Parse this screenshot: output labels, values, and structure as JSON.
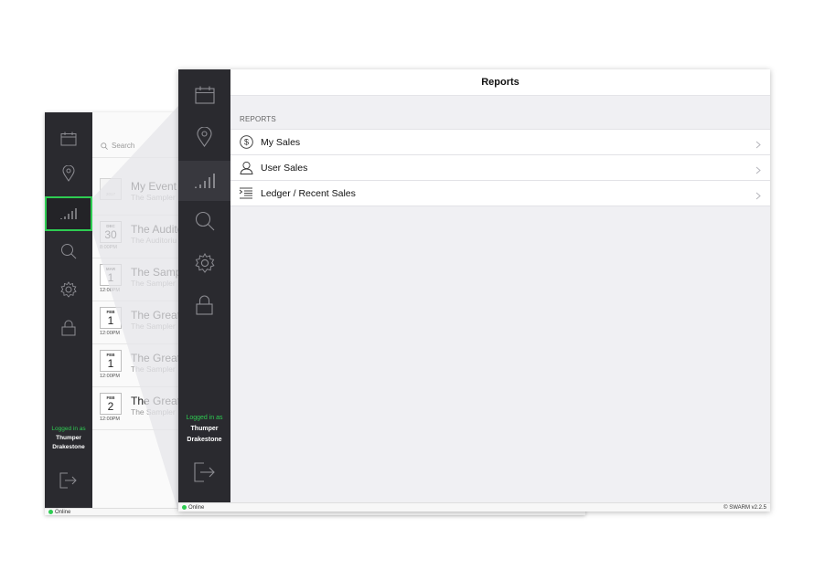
{
  "app": {
    "status": "Online",
    "version": "© SWARM v2.2.5"
  },
  "user": {
    "logged_in_label": "Logged in as",
    "first_name": "Thumper",
    "last_name": "Drakestone"
  },
  "sidebar": {
    "icons": [
      "calendar-icon",
      "location-pin-icon",
      "reports-icon",
      "search-icon",
      "gear-icon",
      "lock-icon",
      "logout-icon"
    ],
    "accent_color": "#2ecc52",
    "background_color": "#2a2a2f"
  },
  "events_screen": {
    "search": {
      "placeholder": "Search"
    },
    "events": [
      {
        "month": "",
        "day": "",
        "time": "",
        "year": "2017",
        "title": "My Event",
        "venue": "The Sampler"
      },
      {
        "month": "DEC",
        "day": "30",
        "time": "8:00PM",
        "title": "The Audito",
        "venue": "The Auditoriu"
      },
      {
        "month": "MAR",
        "day": "1",
        "time": "12:00PM",
        "title": "The Samp",
        "venue": "The Sampler"
      },
      {
        "month": "FEB",
        "day": "1",
        "time": "12:00PM",
        "title": "The Great",
        "venue": "The Sampler"
      },
      {
        "month": "FEB",
        "day": "1",
        "time": "12:00PM",
        "title": "The Great",
        "venue": "The Sampler"
      },
      {
        "month": "FEB",
        "day": "2",
        "time": "12:00PM",
        "title": "The Great",
        "venue": "The Sampler"
      }
    ]
  },
  "reports_screen": {
    "title": "Reports",
    "section_label": "REPORTS",
    "items": [
      {
        "label": "My Sales",
        "icon": "dollar-circle-icon"
      },
      {
        "label": "User Sales",
        "icon": "user-icon"
      },
      {
        "label": "Ledger / Recent Sales",
        "icon": "ledger-list-icon"
      }
    ]
  }
}
